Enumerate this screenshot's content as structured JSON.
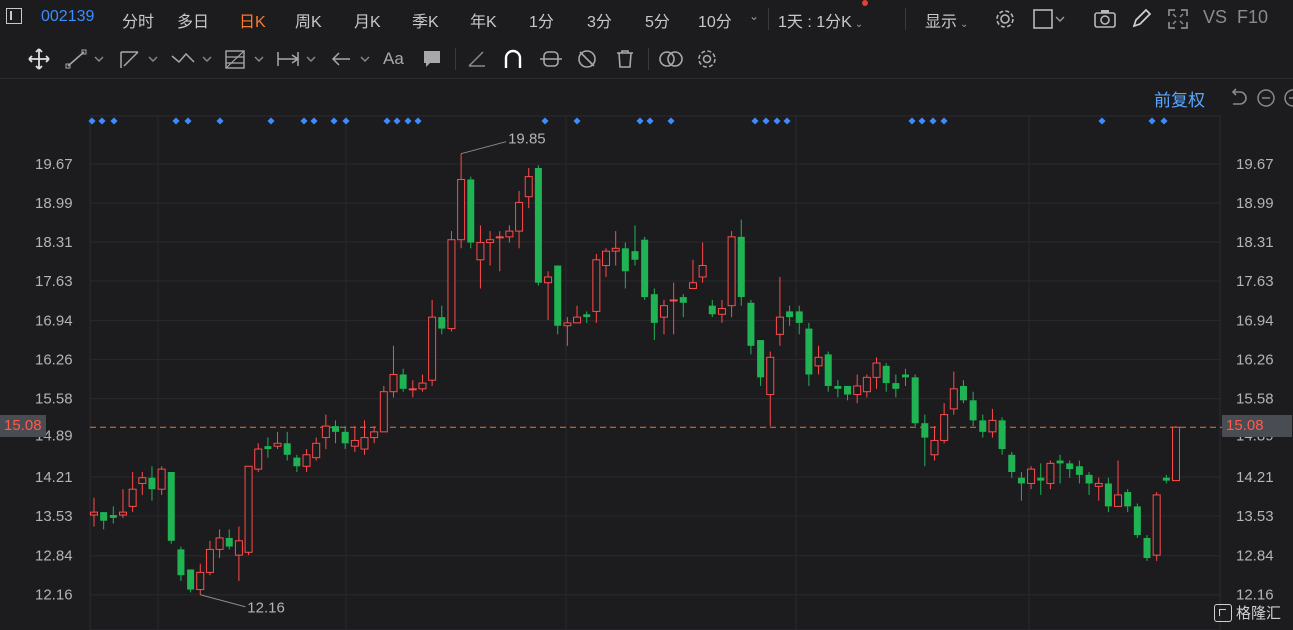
{
  "toolbar": {
    "code": "002139",
    "periods": [
      "分时",
      "多日",
      "日K",
      "周K",
      "月K",
      "季K",
      "年K",
      "1分",
      "3分",
      "5分",
      "10分"
    ],
    "active_period": "日K",
    "combo": "1天 : 1分K",
    "display": "显示",
    "vs": "VS",
    "f10": "F10"
  },
  "adjust_label": "前复权",
  "chart_data": {
    "type": "candlestick",
    "y_ticks": [
      "19.67",
      "18.99",
      "18.31",
      "17.63",
      "16.94",
      "16.26",
      "15.58",
      "15.08",
      "14.21",
      "13.53",
      "12.84",
      "12.16"
    ],
    "current_price": "15.08",
    "high_label": "19.85",
    "low_label": "12.16",
    "candles": [
      [
        13.55,
        13.6,
        13.85,
        13.35
      ],
      [
        13.6,
        13.45,
        13.6,
        13.3
      ],
      [
        13.55,
        13.5,
        13.7,
        13.4
      ],
      [
        13.55,
        13.6,
        14.0,
        13.5
      ],
      [
        13.7,
        14.0,
        14.3,
        13.6
      ],
      [
        14.1,
        14.2,
        14.3,
        13.9
      ],
      [
        14.2,
        14.0,
        14.4,
        13.8
      ],
      [
        14.0,
        14.35,
        14.4,
        13.9
      ],
      [
        14.3,
        13.1,
        14.3,
        13.05
      ],
      [
        12.95,
        12.5,
        13.0,
        12.4
      ],
      [
        12.6,
        12.25,
        12.6,
        12.2
      ],
      [
        12.25,
        12.55,
        12.7,
        12.16
      ],
      [
        12.55,
        12.95,
        13.1,
        12.5
      ],
      [
        12.95,
        13.15,
        13.3,
        12.8
      ],
      [
        13.15,
        13.0,
        13.3,
        12.95
      ],
      [
        12.85,
        13.1,
        13.35,
        12.4
      ],
      [
        12.9,
        14.4,
        14.4,
        12.85
      ],
      [
        14.35,
        14.7,
        14.8,
        14.3
      ],
      [
        14.75,
        14.7,
        14.9,
        14.55
      ],
      [
        14.75,
        14.8,
        15.0,
        14.7
      ],
      [
        14.8,
        14.6,
        15.0,
        14.5
      ],
      [
        14.55,
        14.4,
        14.6,
        14.3
      ],
      [
        14.4,
        14.6,
        14.7,
        14.3
      ],
      [
        14.55,
        14.8,
        14.9,
        14.5
      ],
      [
        14.9,
        15.1,
        15.3,
        14.7
      ],
      [
        15.1,
        15.0,
        15.2,
        14.8
      ],
      [
        15.0,
        14.8,
        15.1,
        14.7
      ],
      [
        14.75,
        14.85,
        15.1,
        14.65
      ],
      [
        14.7,
        14.9,
        15.2,
        14.6
      ],
      [
        14.9,
        15.0,
        15.1,
        14.8
      ],
      [
        15.0,
        15.7,
        15.8,
        15.0
      ],
      [
        15.7,
        16.0,
        16.5,
        15.6
      ],
      [
        16.0,
        15.75,
        16.1,
        15.7
      ],
      [
        15.75,
        15.75,
        15.9,
        15.6
      ],
      [
        15.75,
        15.85,
        16.0,
        15.7
      ],
      [
        15.9,
        17.0,
        17.3,
        15.8
      ],
      [
        17.0,
        16.8,
        17.2,
        16.7
      ],
      [
        16.8,
        18.35,
        18.5,
        16.75
      ],
      [
        18.35,
        19.4,
        19.85,
        18.2
      ],
      [
        19.4,
        18.3,
        19.45,
        18.2
      ],
      [
        18.0,
        18.3,
        18.6,
        17.5
      ],
      [
        18.3,
        18.35,
        18.5,
        17.9
      ],
      [
        18.4,
        18.4,
        18.5,
        17.8
      ],
      [
        18.4,
        18.5,
        18.6,
        18.3
      ],
      [
        18.5,
        19.0,
        19.2,
        18.2
      ],
      [
        19.1,
        19.45,
        19.6,
        18.9
      ],
      [
        19.6,
        17.6,
        19.65,
        17.55
      ],
      [
        17.6,
        17.7,
        17.8,
        16.95
      ],
      [
        17.9,
        16.85,
        17.9,
        16.7
      ],
      [
        16.85,
        16.9,
        17.0,
        16.5
      ],
      [
        16.9,
        17.0,
        17.2,
        16.9
      ],
      [
        17.05,
        17.0,
        17.1,
        16.9
      ],
      [
        17.1,
        18.0,
        18.1,
        16.9
      ],
      [
        17.9,
        18.15,
        18.2,
        17.7
      ],
      [
        18.15,
        18.2,
        18.5,
        17.9
      ],
      [
        18.2,
        17.8,
        18.3,
        17.5
      ],
      [
        18.15,
        18.0,
        18.6,
        17.9
      ],
      [
        18.35,
        17.35,
        18.4,
        17.3
      ],
      [
        17.4,
        16.9,
        17.5,
        16.6
      ],
      [
        17.0,
        17.2,
        17.3,
        16.7
      ],
      [
        17.3,
        17.3,
        17.6,
        16.7
      ],
      [
        17.35,
        17.25,
        17.4,
        17.0
      ],
      [
        17.5,
        17.6,
        18.0,
        17.5
      ],
      [
        17.7,
        17.9,
        18.3,
        17.6
      ],
      [
        17.2,
        17.05,
        17.3,
        17.0
      ],
      [
        17.05,
        17.15,
        17.3,
        16.9
      ],
      [
        17.2,
        18.4,
        18.5,
        17.0
      ],
      [
        18.4,
        17.35,
        18.7,
        17.2
      ],
      [
        17.25,
        16.5,
        17.3,
        16.35
      ],
      [
        16.6,
        15.95,
        16.6,
        15.8
      ],
      [
        15.65,
        16.3,
        16.4,
        15.1
      ],
      [
        16.7,
        17.0,
        17.7,
        16.5
      ],
      [
        17.1,
        17.0,
        17.2,
        16.85
      ],
      [
        17.1,
        16.9,
        17.2,
        16.7
      ],
      [
        16.8,
        16.0,
        16.9,
        15.8
      ],
      [
        16.15,
        16.3,
        16.5,
        16.0
      ],
      [
        16.35,
        15.8,
        16.4,
        15.7
      ],
      [
        15.8,
        15.75,
        15.9,
        15.6
      ],
      [
        15.8,
        15.65,
        15.8,
        15.55
      ],
      [
        15.65,
        15.8,
        16.0,
        15.5
      ],
      [
        15.7,
        15.95,
        16.0,
        15.6
      ],
      [
        15.95,
        16.2,
        16.3,
        15.75
      ],
      [
        16.15,
        15.85,
        16.2,
        15.7
      ],
      [
        15.85,
        15.75,
        16.0,
        15.6
      ],
      [
        16.0,
        15.95,
        16.1,
        15.8
      ],
      [
        15.95,
        15.15,
        16.0,
        15.1
      ],
      [
        15.15,
        14.9,
        15.3,
        14.4
      ],
      [
        14.6,
        14.85,
        15.1,
        14.5
      ],
      [
        14.85,
        15.3,
        15.5,
        14.8
      ],
      [
        15.4,
        15.75,
        16.05,
        15.3
      ],
      [
        15.8,
        15.55,
        15.9,
        15.5
      ],
      [
        15.55,
        15.2,
        15.7,
        15.1
      ],
      [
        15.2,
        15.0,
        15.3,
        14.9
      ],
      [
        15.0,
        15.2,
        15.4,
        14.9
      ],
      [
        15.2,
        14.7,
        15.25,
        14.6
      ],
      [
        14.6,
        14.3,
        14.65,
        14.2
      ],
      [
        14.2,
        14.1,
        14.3,
        13.8
      ],
      [
        14.1,
        14.35,
        14.4,
        14.0
      ],
      [
        14.2,
        14.15,
        14.45,
        13.9
      ],
      [
        14.1,
        14.45,
        14.5,
        14.0
      ],
      [
        14.5,
        14.45,
        14.6,
        14.1
      ],
      [
        14.45,
        14.35,
        14.5,
        14.2
      ],
      [
        14.4,
        14.25,
        14.5,
        14.1
      ],
      [
        14.25,
        14.1,
        14.3,
        13.9
      ],
      [
        14.05,
        14.1,
        14.2,
        13.8
      ],
      [
        14.1,
        13.7,
        14.2,
        13.6
      ],
      [
        13.7,
        13.9,
        14.5,
        13.7
      ],
      [
        13.95,
        13.7,
        14.0,
        13.6
      ],
      [
        13.7,
        13.2,
        13.75,
        13.15
      ],
      [
        13.15,
        12.8,
        13.2,
        12.75
      ],
      [
        12.85,
        13.9,
        13.95,
        12.75
      ],
      [
        14.2,
        14.15,
        14.25,
        14.1
      ],
      [
        14.15,
        15.08,
        15.1,
        14.15
      ]
    ],
    "markers": [
      92,
      102,
      114,
      176,
      188,
      220,
      271,
      304,
      314,
      334,
      346,
      387,
      397,
      408,
      418,
      545,
      577,
      640,
      650,
      671,
      755,
      766,
      777,
      787,
      912,
      922,
      933,
      944,
      1102,
      1152,
      1164
    ]
  }
}
